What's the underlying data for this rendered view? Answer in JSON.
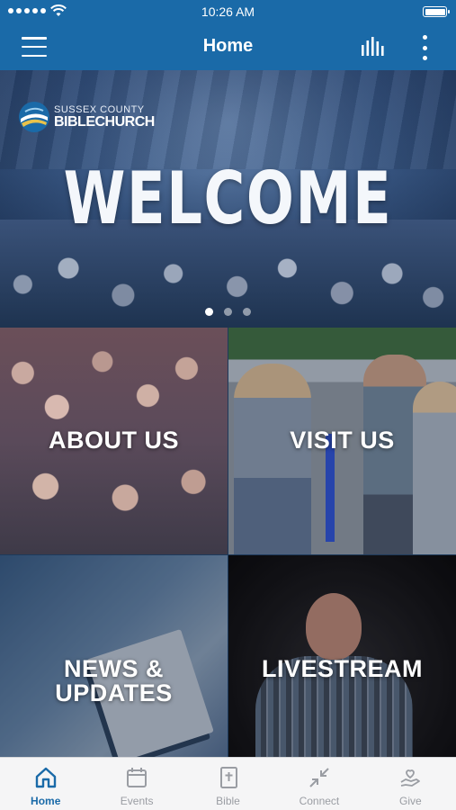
{
  "status_bar": {
    "time": "10:26 AM",
    "icons": [
      "signal-dots-icon",
      "wifi-icon",
      "battery-icon"
    ]
  },
  "header": {
    "title": "Home",
    "menu_icon": "hamburger-menu-icon",
    "audio_icon": "audio-bars-icon",
    "more_icon": "more-vertical-icon"
  },
  "hero": {
    "logo_line1": "SUSSEX COUNTY",
    "logo_line2": "BIBLECHURCH",
    "headline": "WELCOME",
    "slide_count": 3,
    "active_slide": 1
  },
  "tiles": [
    {
      "line1": "ABOUT US",
      "line2": ""
    },
    {
      "line1": "VISIT US",
      "line2": ""
    },
    {
      "line1": "NEWS &",
      "line2": "UPDATES"
    },
    {
      "line1": "LIVESTREAM",
      "line2": ""
    }
  ],
  "tab_bar": {
    "items": [
      {
        "label": "Home",
        "icon": "home-icon",
        "active": true
      },
      {
        "label": "Events",
        "icon": "calendar-icon",
        "active": false
      },
      {
        "label": "Bible",
        "icon": "bible-icon",
        "active": false
      },
      {
        "label": "Connect",
        "icon": "connect-arrows-icon",
        "active": false
      },
      {
        "label": "Give",
        "icon": "give-heart-hand-icon",
        "active": false
      }
    ]
  },
  "colors": {
    "brand": "#1a6aa8",
    "tab_inactive": "#9a9da3",
    "tab_bar_bg": "#f5f5f6"
  }
}
